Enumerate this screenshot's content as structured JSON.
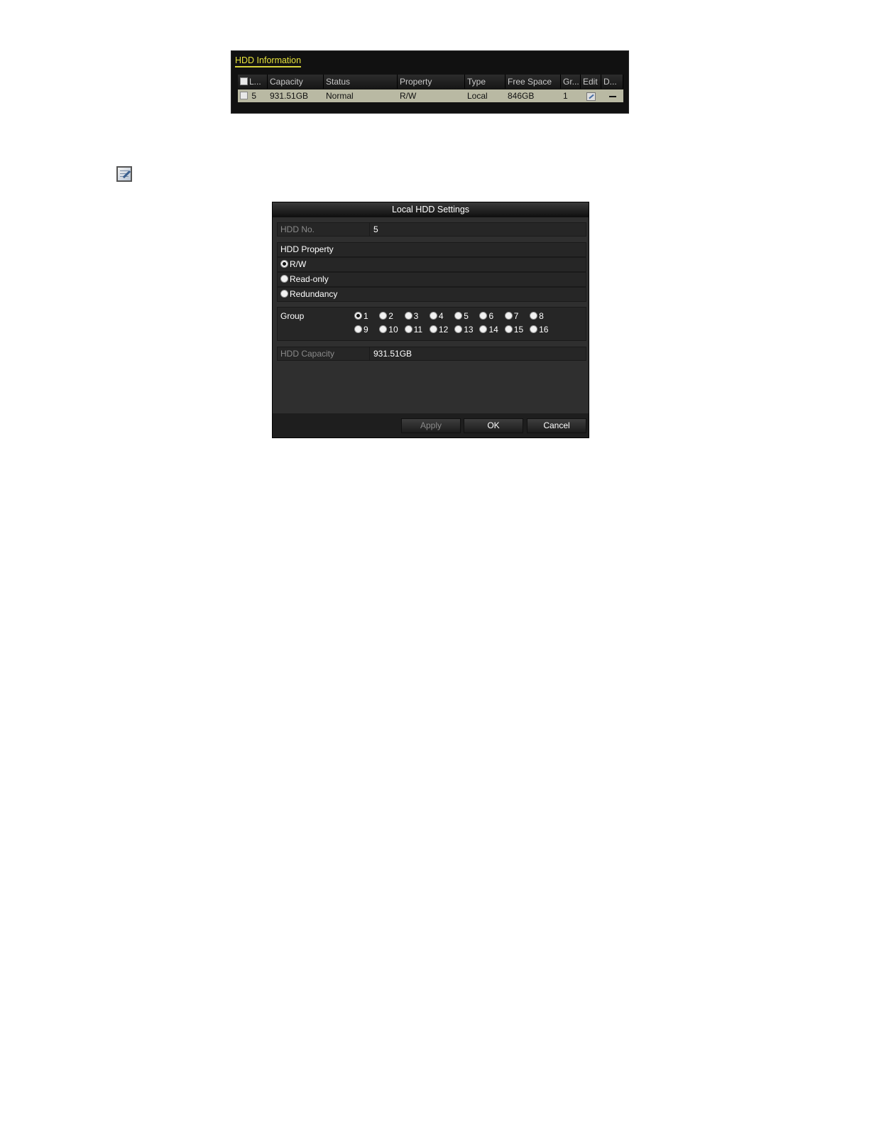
{
  "hdd_info": {
    "title": "HDD Information",
    "columns": [
      "L...",
      "Capacity",
      "Status",
      "Property",
      "Type",
      "Free Space",
      "Gr...",
      "Edit",
      "D..."
    ],
    "rows": [
      {
        "label": "5",
        "capacity": "931.51GB",
        "status": "Normal",
        "property": "R/W",
        "type": "Local",
        "free_space": "846GB",
        "group": "1"
      }
    ]
  },
  "dialog": {
    "title": "Local HDD Settings",
    "hdd_no_label": "HDD No.",
    "hdd_no_value": "5",
    "property_header": "HDD Property",
    "property_options": [
      "R/W",
      "Read-only",
      "Redundancy"
    ],
    "property_selected": "R/W",
    "group_label": "Group",
    "groups_row1": [
      "1",
      "2",
      "3",
      "4",
      "5",
      "6",
      "7",
      "8"
    ],
    "groups_row2": [
      "9",
      "10",
      "11",
      "12",
      "13",
      "14",
      "15",
      "16"
    ],
    "group_selected": "1",
    "capacity_label": "HDD Capacity",
    "capacity_value": "931.51GB",
    "buttons": {
      "apply": "Apply",
      "ok": "OK",
      "cancel": "Cancel"
    }
  },
  "icons": {
    "edit": "edit-icon",
    "delete": "dash-icon"
  },
  "colors": {
    "title_accent": "#e6e23c",
    "row_highlight": "#b9b9a3",
    "dialog_bg": "#2f2f2f"
  }
}
